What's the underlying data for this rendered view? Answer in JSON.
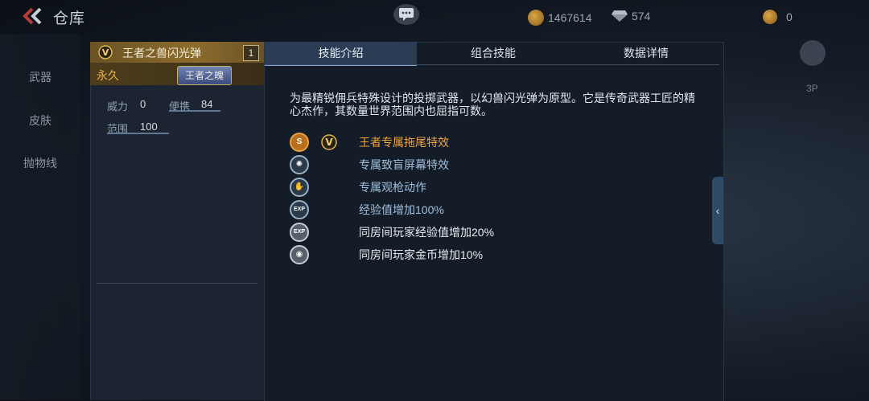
{
  "header": {
    "title": "仓库",
    "gold": "1467614",
    "diamonds": "574",
    "medals": "0"
  },
  "nav": {
    "items": [
      {
        "label": "武器"
      },
      {
        "label": "皮肤"
      },
      {
        "label": "抛物线"
      }
    ]
  },
  "item": {
    "name": "王者之兽闪光弹",
    "count": "1",
    "duration": "永久",
    "badge": "王者之魄",
    "stats": [
      {
        "label": "威力",
        "value": "0"
      },
      {
        "label": "便携",
        "value": "84"
      },
      {
        "label": "范围",
        "value": "100"
      }
    ]
  },
  "tabs": [
    {
      "label": "技能介绍",
      "active": true
    },
    {
      "label": "组合技能",
      "active": false
    },
    {
      "label": "数据详情",
      "active": false
    }
  ],
  "description": "为最精锐佣兵特殊设计的投掷武器，以幻兽闪光弹为原型。它是传奇武器工匠的精心杰作，其数量世界范围内也屈指可数。",
  "skills": [
    {
      "text": "王者专属拖尾特效",
      "icon": "king-trail-icon",
      "color": "#f0a23a"
    },
    {
      "text": "专属致盲屏幕特效",
      "icon": "blind-effect-icon",
      "color": "#9fc0de"
    },
    {
      "text": "专属观枪动作",
      "icon": "inspect-action-icon",
      "color": "#9fc0de"
    },
    {
      "text": "经验值增加100%",
      "icon": "exp-icon",
      "color": "#9fc0de"
    },
    {
      "text": "同房间玩家经验值增加20%",
      "icon": "room-exp-icon",
      "color": "#e8ecf0"
    },
    {
      "text": "同房间玩家金币增加10%",
      "icon": "room-gold-icon",
      "color": "#e8ecf0"
    }
  ],
  "right": {
    "view_label": "3P"
  }
}
